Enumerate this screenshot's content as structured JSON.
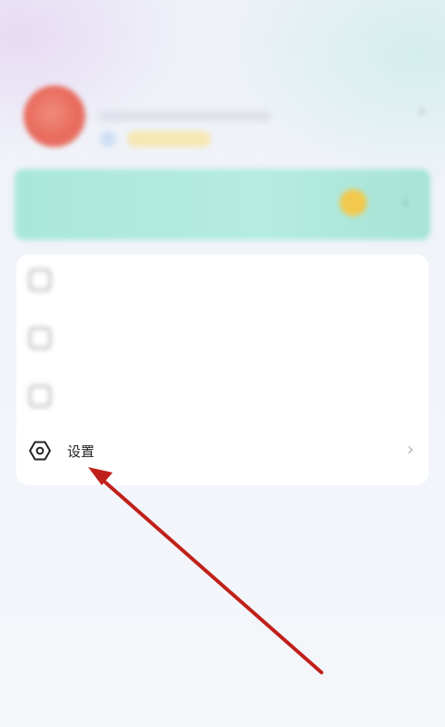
{
  "status_bar": {
    "left": "",
    "center": "",
    "right": ""
  },
  "profile": {
    "name": "",
    "chevron_icon": "chevron-right-icon"
  },
  "banner": {
    "text": ""
  },
  "menu": {
    "items": [
      {
        "label": "",
        "icon": "blurred-icon"
      },
      {
        "label": "",
        "icon": "blurred-icon"
      },
      {
        "label": "",
        "icon": "blurred-icon"
      },
      {
        "label": "设置",
        "icon": "settings-hex-icon"
      }
    ]
  },
  "colors": {
    "annotation_arrow": "#c0201a",
    "banner": "#a9e7d9",
    "avatar": "#e86a5c"
  }
}
